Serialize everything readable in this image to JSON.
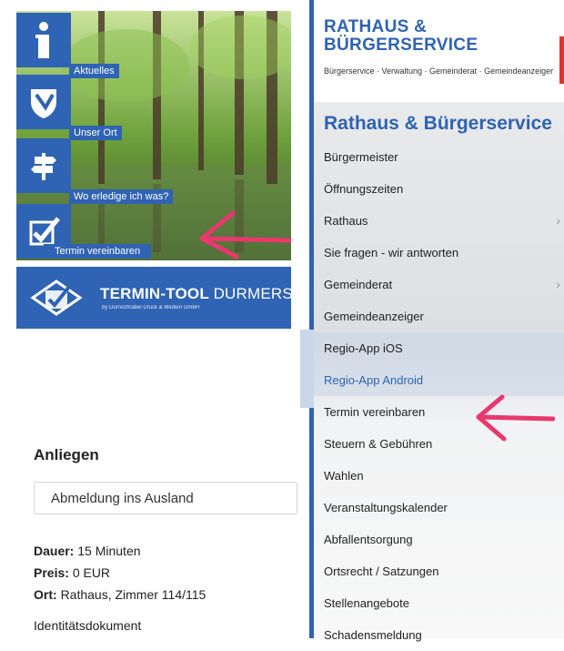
{
  "left": {
    "tiles": [
      {
        "label": "Aktuelles",
        "icon": "info-icon"
      },
      {
        "label": "Unser Ort",
        "icon": "coat-of-arms-icon"
      },
      {
        "label": "Wo erledige ich was?",
        "icon": "signpost-icon"
      },
      {
        "label": "Termin vereinbaren",
        "icon": "checklist-icon"
      }
    ],
    "banner": {
      "title_bold": "TERMIN-TOOL",
      "title_light": "DURMERSHEIM",
      "subtitle": "by Dürnschrabel Druck & Medien GmbH"
    },
    "form": {
      "heading": "Anliegen",
      "selected_value": "Abmeldung ins Ausland",
      "dauer_label": "Dauer:",
      "dauer_value": "15 Minuten",
      "preis_label": "Preis:",
      "preis_value": "0 EUR",
      "ort_label": "Ort:",
      "ort_value": "Rathaus, Zimmer 114/115",
      "extra": "Identitätsdokument"
    }
  },
  "right": {
    "brand_title_line1": "RATHAUS &",
    "brand_title_line2": "BÜRGERSERVICE",
    "brand_subtitle": "Bürgerservice · Verwaltung · Gemeinderat · Gemeindeanzeiger",
    "menu_title": "Rathaus & Bürgerservice",
    "menu_items": [
      {
        "label": "Bürgermeister"
      },
      {
        "label": "Öffnungszeiten"
      },
      {
        "label": "Rathaus",
        "chevron": "›"
      },
      {
        "label": "Sie fragen - wir antworten"
      },
      {
        "label": "Gemeinderat",
        "chevron": "›"
      },
      {
        "label": "Gemeindeanzeiger"
      },
      {
        "label": "Regio-App iOS"
      },
      {
        "label": "Regio-App Android"
      },
      {
        "label": "Termin vereinbaren"
      },
      {
        "label": "Steuern & Gebühren"
      },
      {
        "label": "Wahlen"
      },
      {
        "label": "Veranstaltungskalender"
      },
      {
        "label": "Abfallentsorgung"
      },
      {
        "label": "Ortsrecht / Satzungen"
      },
      {
        "label": "Stellenangebote"
      },
      {
        "label": "Schadensmeldung"
      }
    ]
  },
  "colors": {
    "brand_blue": "#2f63b3",
    "annotation_pink": "#e8386d",
    "accent_red": "#e3342f"
  }
}
